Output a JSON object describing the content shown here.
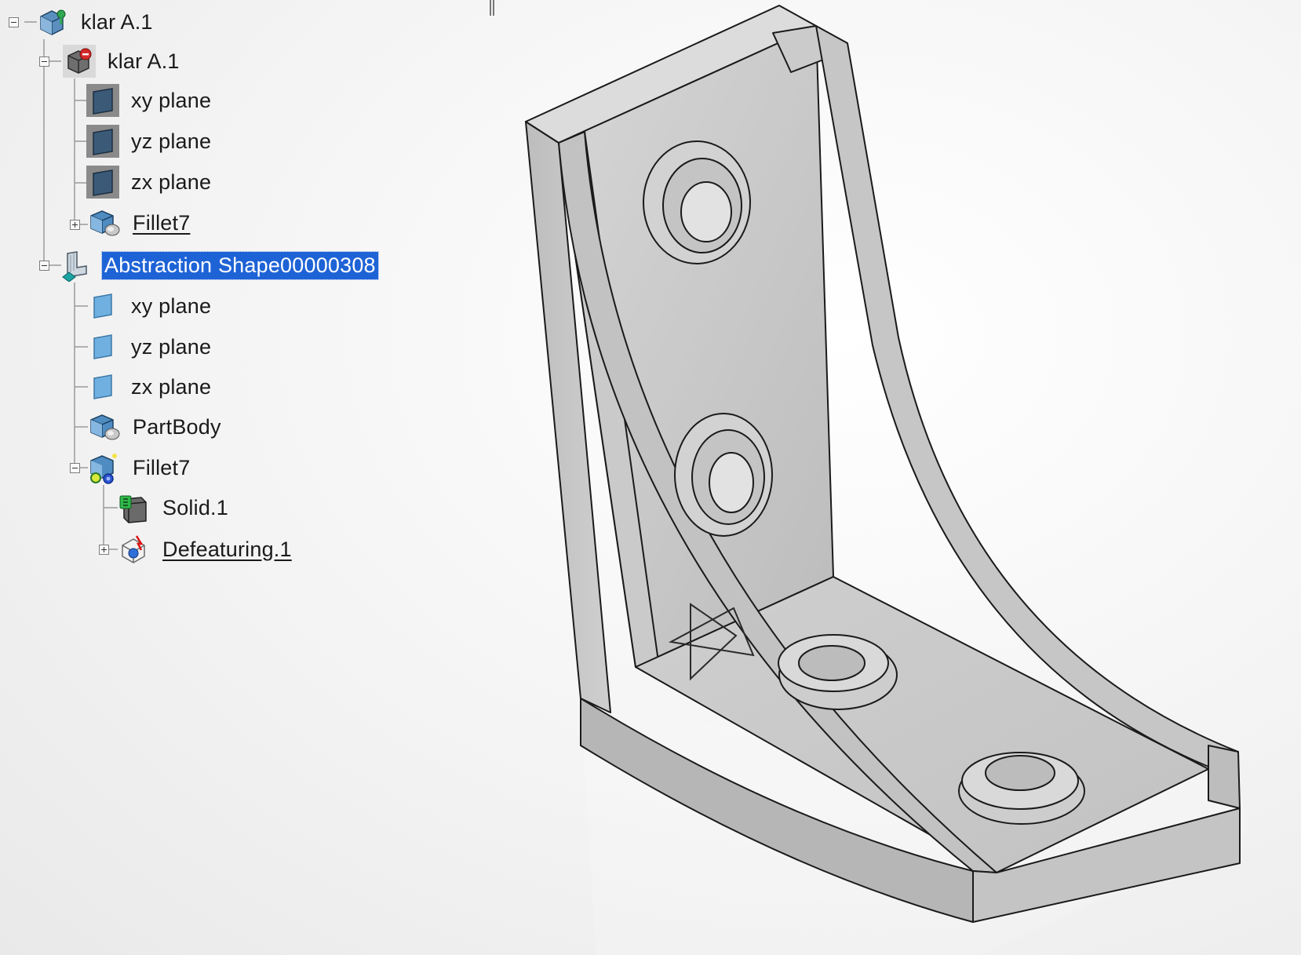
{
  "tree": {
    "nodes": [
      {
        "label": "klar A.1",
        "icon": "product-icon"
      },
      {
        "label": "klar A.1",
        "icon": "part-icon"
      },
      {
        "label": "xy plane",
        "icon": "plane-icon"
      },
      {
        "label": "yz plane",
        "icon": "plane-icon"
      },
      {
        "label": "zx plane",
        "icon": "plane-icon"
      },
      {
        "label": "Fillet7",
        "icon": "body-icon"
      },
      {
        "label": "Abstraction Shape00000308",
        "icon": "abstraction-shape-icon"
      },
      {
        "label": "xy plane",
        "icon": "plane-icon"
      },
      {
        "label": "yz plane",
        "icon": "plane-icon"
      },
      {
        "label": "zx plane",
        "icon": "plane-icon"
      },
      {
        "label": "PartBody",
        "icon": "body-icon"
      },
      {
        "label": "Fillet7",
        "icon": "fillet-icon"
      },
      {
        "label": "Solid.1",
        "icon": "solid-icon"
      },
      {
        "label": "Defeaturing.1",
        "icon": "defeaturing-icon"
      }
    ]
  },
  "colors": {
    "selection": "#1e63d6",
    "part_face": "#c8c8c8",
    "part_edge": "#1a1a1a",
    "plane_dark": "#3a5a78",
    "plane_light": "#6fb0e0"
  }
}
